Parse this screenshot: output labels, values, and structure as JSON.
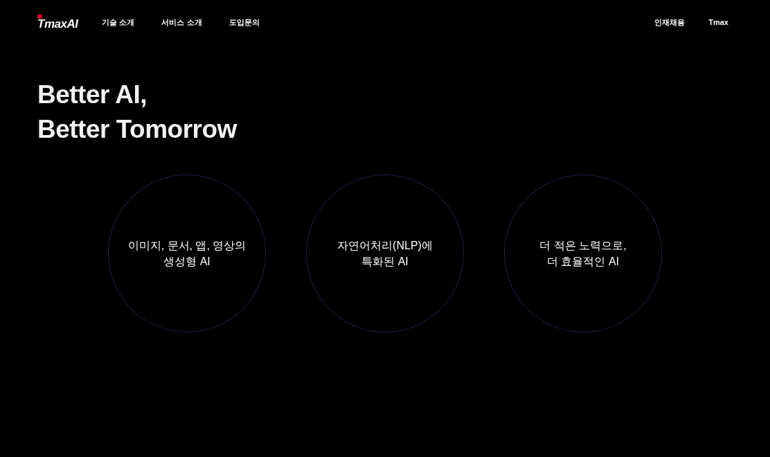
{
  "header": {
    "logo": "TmaxAI",
    "nav_left": [
      "기술 소개",
      "서비스 소개",
      "도입문의"
    ],
    "nav_right": [
      "인재채용",
      "Tmax"
    ]
  },
  "hero": {
    "title_lines": [
      "Better AI,",
      "Better Tomorrow"
    ]
  },
  "features": [
    {
      "caption": "이미지, 문서, 앱, 영상의\n생성형 AI"
    },
    {
      "caption": "자연어처리(NLP)에\n특화된 AI"
    },
    {
      "caption": "더 적은 노력으로,\n더 효율적인 AI"
    }
  ]
}
